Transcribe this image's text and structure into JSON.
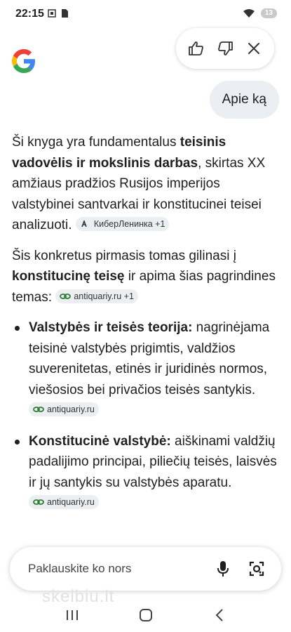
{
  "status": {
    "time": "22:15",
    "battery": "13"
  },
  "feedback": {
    "like": "thumbs-up",
    "dislike": "thumbs-down",
    "close": "close"
  },
  "query": "Apie ką",
  "para1": {
    "t1": "Ši knyga yra fundamentalus ",
    "b1": "teisinis vadovėlis ir mokslinis darbas",
    "t2": ", skirtas XX amžiaus pradžios Rusijos imperijos valstybinei santvarkai ir konstitucinei teisei analizuoti. ",
    "chip": "КиберЛенинка +1"
  },
  "para2": {
    "t1": "Šis konkretus pirmasis tomas gilinasi į ",
    "b1": "konstitucinę teisę",
    "t2": " ir apima šias pagrindines temas: ",
    "chip": "antiquariy.ru +1"
  },
  "bullets": [
    {
      "bold": "Valstybės ir teisės teorija:",
      "text": " nagrinėjama teisinė valstybės prigimtis, valdžios suverenitetas, etinės ir juridinės normos, viešosios bei privačios teisės santykis. ",
      "chip": "antiquariy.ru"
    },
    {
      "bold": "Konstitucinė valstybė:",
      "text": " aiškinami valdžių padalijimo principai, piliečių teisės, laisvės ir jų santykis su valstybės aparatu. ",
      "chip": "antiquariy.ru"
    }
  ],
  "input": {
    "placeholder": "Paklauskite ko nors"
  },
  "watermark": "skelbiu.lt",
  "colors": {
    "blue": "#4285F4",
    "red": "#EA4335",
    "yellow": "#FBBC05",
    "green": "#34A853",
    "bubble": "#ebeef2"
  }
}
